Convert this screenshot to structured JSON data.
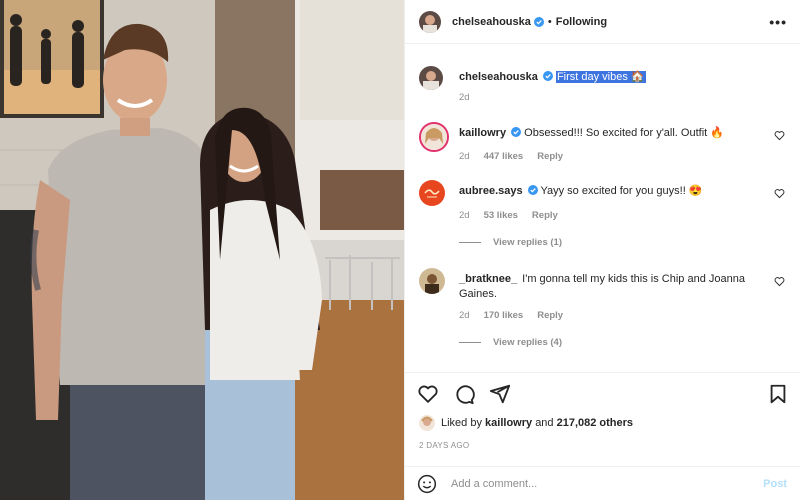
{
  "header": {
    "username": "chelseahouska",
    "separator": "•",
    "follow_status": "Following",
    "more_icon": "more-icon"
  },
  "caption": {
    "username": "chelseahouska",
    "text": "First day vibes 🏠",
    "time": "2d"
  },
  "comments": [
    {
      "username": "kaillowry",
      "verified": true,
      "text": "Obsessed!!! So excited for y'all. Outfit 🔥",
      "time": "2d",
      "likes": "447 likes",
      "reply": "Reply"
    },
    {
      "username": "aubree.says",
      "verified": true,
      "text": "Yayy so excited for you guys!! 😍",
      "time": "2d",
      "likes": "53 likes",
      "reply": "Reply",
      "view_replies": "View replies (1)"
    },
    {
      "username": "_bratknee_",
      "verified": false,
      "text": "I'm gonna tell my kids this is Chip and Joanna Gaines.",
      "time": "2d",
      "likes": "170 likes",
      "reply": "Reply",
      "view_replies": "View replies (4)"
    }
  ],
  "actions": {
    "liked_prefix": "Liked by",
    "liked_user": "kaillowry",
    "liked_and": "and",
    "liked_others": "217,082 others",
    "posted_ago": "2 DAYS AGO"
  },
  "add_comment": {
    "placeholder": "Add a comment...",
    "post_label": "Post"
  },
  "colors": {
    "verified": "#3897f0",
    "highlight": "#3d74e0",
    "muted": "#8e8e8e",
    "post_disabled": "#b2dffc"
  }
}
